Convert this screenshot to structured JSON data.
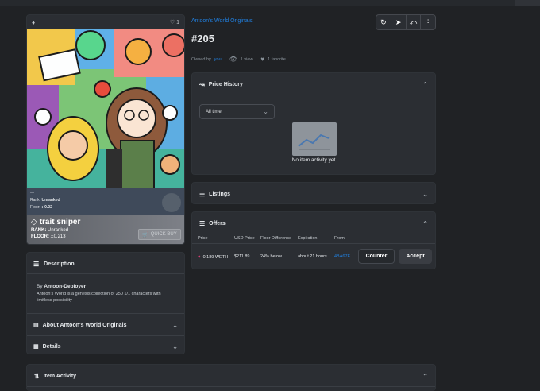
{
  "nft": {
    "collection": "Antoon's World Originals",
    "title": "#205",
    "owned_by_label": "Owned by",
    "owner": "you",
    "views": "1 view",
    "favorites": "1 favorite",
    "favorite_count": "1"
  },
  "image_overlay": {
    "top_line": "—",
    "rank_label": "Rank:",
    "rank_value": "Unranked",
    "floor_label": "Floor:",
    "floor_value": "♦ 0.22"
  },
  "sniper": {
    "brand": "trait sniper",
    "rank_label": "RANK:",
    "rank_value": "Unranked",
    "floor_label": "FLOOR:",
    "floor_value": "Ξ0.213",
    "quick_buy": "QUICK BUY"
  },
  "description": {
    "header": "Description",
    "by_label": "By",
    "creator": "Antoon-Deployer",
    "text": "Antoon's World is a genesis collection of 250 1/1 characters with limitless possibility"
  },
  "about": {
    "header": "About Antoon's World Originals"
  },
  "details": {
    "header": "Details"
  },
  "price_history": {
    "header": "Price History",
    "range": "All time",
    "empty": "No item activity yet"
  },
  "listings": {
    "header": "Listings"
  },
  "offers": {
    "header": "Offers",
    "columns": [
      "Price",
      "USD Price",
      "Floor Difference",
      "Expiration",
      "From"
    ],
    "rows": [
      {
        "price": "0.189 WETH",
        "usd": "$211.89",
        "floor_diff": "24% below",
        "expiration": "about 21 hours",
        "from": "4BA67E"
      }
    ],
    "counter_label": "Counter",
    "accept_label": "Accept"
  },
  "item_activity": {
    "header": "Item Activity"
  },
  "colors": {
    "accent": "#2081e2",
    "background": "#202225",
    "panel": "#2b2e33"
  }
}
